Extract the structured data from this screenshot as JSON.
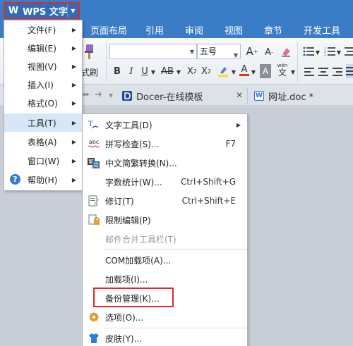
{
  "app": {
    "title": "WPS 文字"
  },
  "tabs": [
    "页面布局",
    "引用",
    "审阅",
    "视图",
    "章节",
    "开发工具"
  ],
  "ribbon": {
    "format_painter_label": "式刷",
    "font_size": "五号"
  },
  "doc_tabs": [
    {
      "label": "Docer-在线模板"
    },
    {
      "label": "网址.doc *"
    }
  ],
  "main_menu": [
    {
      "label": "文件(F)"
    },
    {
      "label": "编辑(E)"
    },
    {
      "label": "视图(V)"
    },
    {
      "label": "插入(I)"
    },
    {
      "label": "格式(O)"
    },
    {
      "label": "工具(T)"
    },
    {
      "label": "表格(A)"
    },
    {
      "label": "窗口(W)"
    },
    {
      "label": "帮助(H)"
    }
  ],
  "tools_menu": [
    {
      "label": "文字工具(D)"
    },
    {
      "label": "拼写检查(S)...",
      "shortcut": "F7"
    },
    {
      "label": "中文简繁转换(N)..."
    },
    {
      "label": "字数统计(W)...",
      "shortcut": "Ctrl+Shift+G"
    },
    {
      "label": "修订(T)",
      "shortcut": "Ctrl+Shift+E"
    },
    {
      "label": "限制编辑(P)"
    },
    {
      "label": "邮件合并工具栏(T)"
    },
    {
      "label": "COM加载项(A)..."
    },
    {
      "label": "加载项(I)..."
    },
    {
      "label": "备份管理(K)..."
    },
    {
      "label": "选项(O)..."
    },
    {
      "label": "皮肤(Y)..."
    }
  ],
  "icons": {
    "app_logo": "wps-logo-icon",
    "spell_abc": "abc"
  },
  "colors": {
    "title_bar": "#3b7cc7",
    "menu_highlight": "#d7e7f8",
    "callout_border": "#e02a2a"
  }
}
